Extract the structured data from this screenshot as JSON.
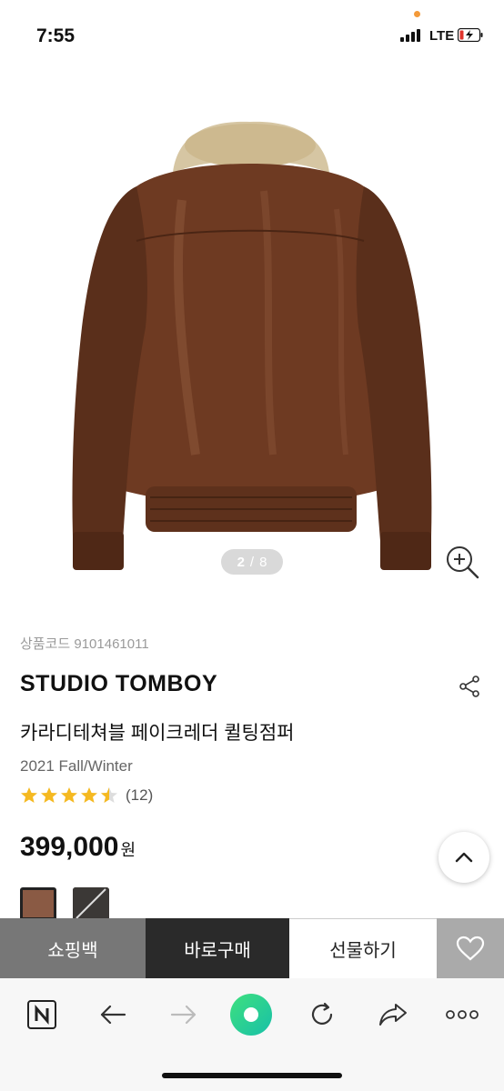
{
  "status_bar": {
    "time": "7:55",
    "network": "LTE"
  },
  "gallery": {
    "current": "2",
    "total": "8",
    "separator": "/"
  },
  "product": {
    "code_label": "상품코드",
    "code": "9101461011",
    "brand": "STUDIO TOMBOY",
    "name": "카라디테쳐블 페이크레더 퀼팅점퍼",
    "season": "2021 Fall/Winter",
    "rating": 4.5,
    "review_count": "(12)",
    "price": "399,000",
    "currency": "원"
  },
  "swatches": [
    {
      "color": "#8a5a44",
      "selected": true
    },
    {
      "color": "#3b3836",
      "selected": false
    }
  ],
  "actions": {
    "bag": "쇼핑백",
    "buy": "바로구매",
    "gift": "선물하기"
  },
  "browser_bar": {
    "icons": [
      "naver-icon",
      "back-icon",
      "forward-icon",
      "green-dot-icon",
      "reload-icon",
      "share-icon",
      "more-icon"
    ]
  },
  "colors": {
    "brand_dark": "#2a2a2a",
    "star": "#f5b921",
    "green_dot": "#2ed47a"
  }
}
